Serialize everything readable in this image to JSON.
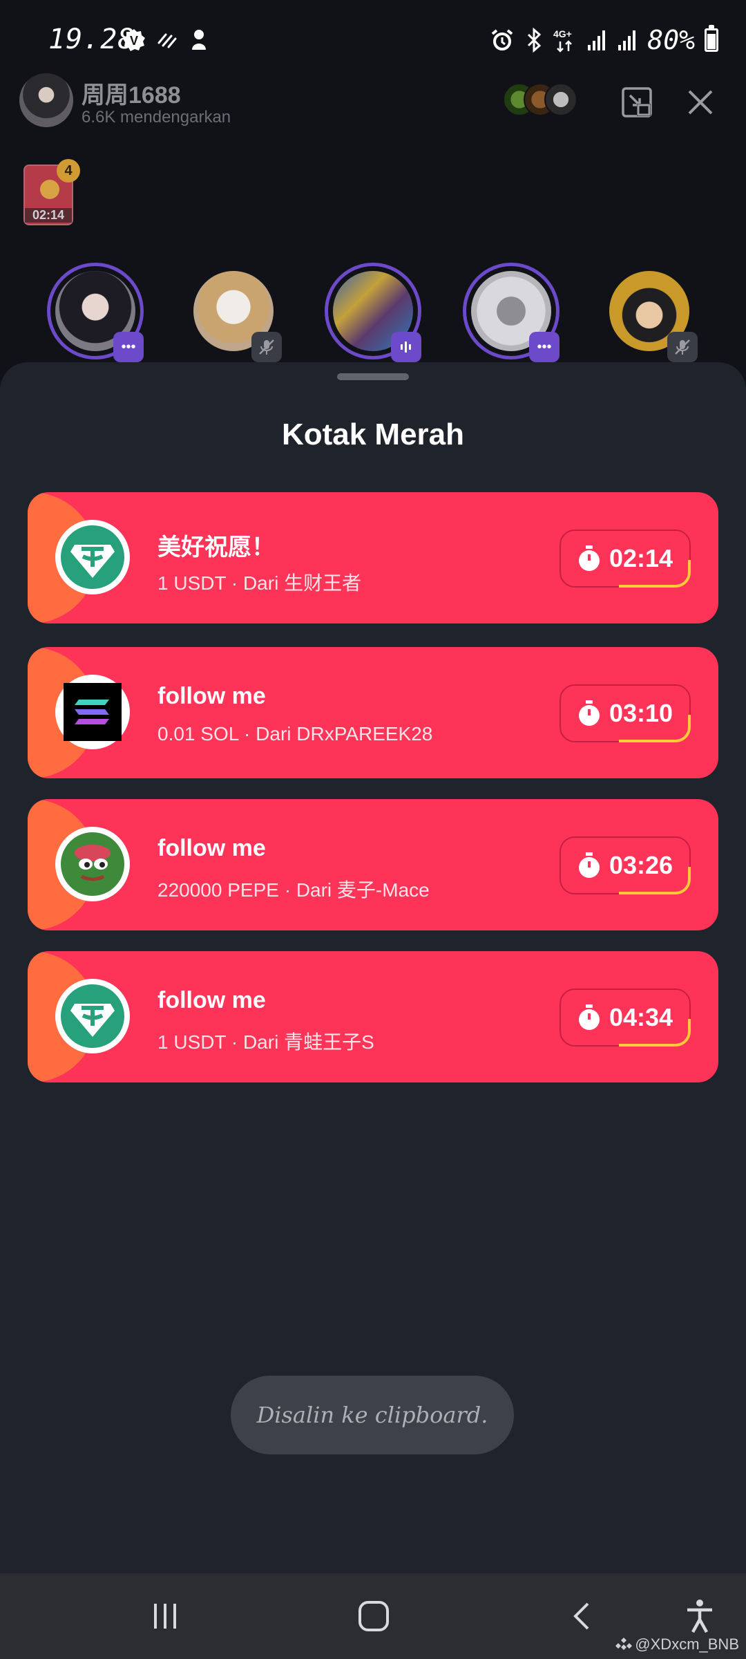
{
  "status_bar": {
    "time": "19.28",
    "battery": "80%",
    "battery_level": 0.8
  },
  "room": {
    "host_name": "周周1688",
    "listeners": "6.6K mendengarkan"
  },
  "red_box_indicator": {
    "timer": "02:14",
    "count": "4"
  },
  "speakers": [
    {
      "name": "speaker-1",
      "active": true,
      "badge": "more-icon"
    },
    {
      "name": "speaker-2",
      "active": false,
      "badge": "mic-off-icon"
    },
    {
      "name": "speaker-3",
      "active": true,
      "badge": "speaking-icon"
    },
    {
      "name": "speaker-4",
      "active": true,
      "badge": "more-icon"
    },
    {
      "name": "speaker-5",
      "active": false,
      "badge": "mic-off-icon"
    }
  ],
  "sheet": {
    "title": "Kotak Merah",
    "items": [
      {
        "message": "美好祝愿！",
        "detail": "1 USDT · Dari 生财王者",
        "timer": "02:14",
        "token": "usdt-icon"
      },
      {
        "message": "follow me",
        "detail": "0.01 SOL · Dari DRxPAREEK28",
        "timer": "03:10",
        "token": "sol-icon"
      },
      {
        "message": "follow me",
        "detail": "220000 PEPE · Dari 麦子-Mace",
        "timer": "03:26",
        "token": "pepe-icon"
      },
      {
        "message": "follow me",
        "detail": "1 USDT · Dari 青蛙王子S",
        "timer": "04:34",
        "token": "usdt-icon"
      }
    ]
  },
  "toast": "Disalin ke clipboard.",
  "watermark": "@XDxcm_BNB",
  "colors": {
    "card": "#fe3358",
    "card_accent": "#ff6c40",
    "sheet": "#1f232b",
    "speaking_ring": "#6c4ac9",
    "timer_arc": "#ffc93a"
  }
}
